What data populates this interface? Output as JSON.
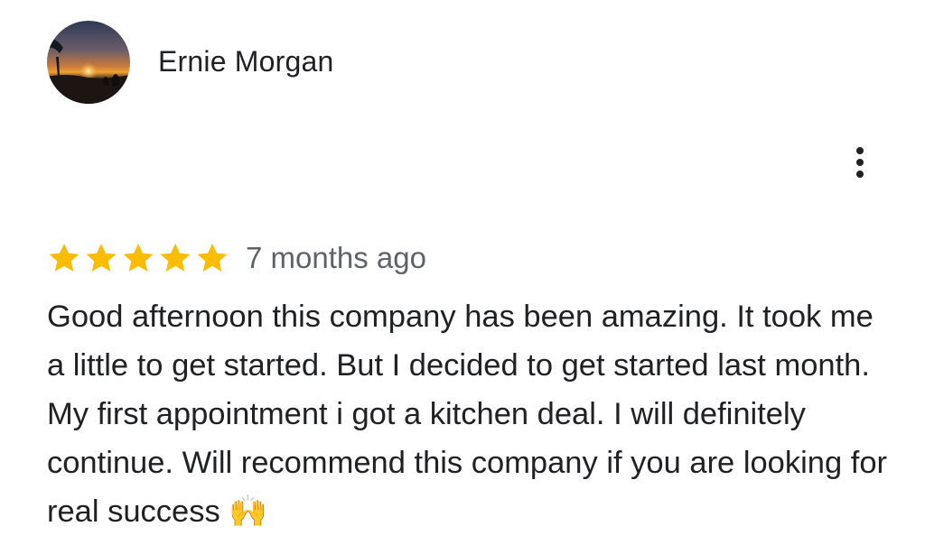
{
  "review": {
    "reviewer_name": "Ernie Morgan",
    "avatar_icon": "sunset-photo-avatar",
    "more_icon": "more-vert-icon",
    "rating": 5,
    "rating_max": 5,
    "star_color": "#fbbc04",
    "date": "7 months ago",
    "text": "Good afternoon this company has been amazing. It took me a little to get started. But I decided to get started last month.  My first appointment i got a kitchen deal. I will definitely continue. Will recommend this company if you are looking for real success 🙌"
  }
}
